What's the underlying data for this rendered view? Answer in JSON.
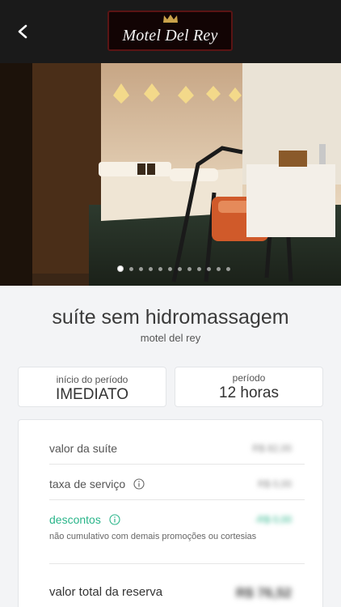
{
  "header": {
    "brand_name": "Motel Del Rey",
    "back_icon": "chevron-left-icon",
    "brand_color": "#5a1414"
  },
  "gallery": {
    "slide_count": 12,
    "active_index": 0
  },
  "suite": {
    "title": "suíte sem hidromassagem",
    "motel": "motel del rey"
  },
  "booking": {
    "start_label": "início do período",
    "start_value": "IMEDIATO",
    "period_label": "período",
    "period_value": "12 horas"
  },
  "pricing": {
    "suite_value_label": "valor da suíte",
    "suite_value": "R$ 82,00",
    "service_fee_label": "taxa de serviço",
    "service_fee": "R$ 0,00",
    "discounts_label": "descontos",
    "discounts_value": "-R$ 0,00",
    "discounts_note": "não cumulativo com demais promoções ou cortesias",
    "total_label": "valor total da reserva",
    "total_value": "R$ 76,52",
    "discount_color": "#2ab58a",
    "info_icon": "info-circle-icon"
  }
}
